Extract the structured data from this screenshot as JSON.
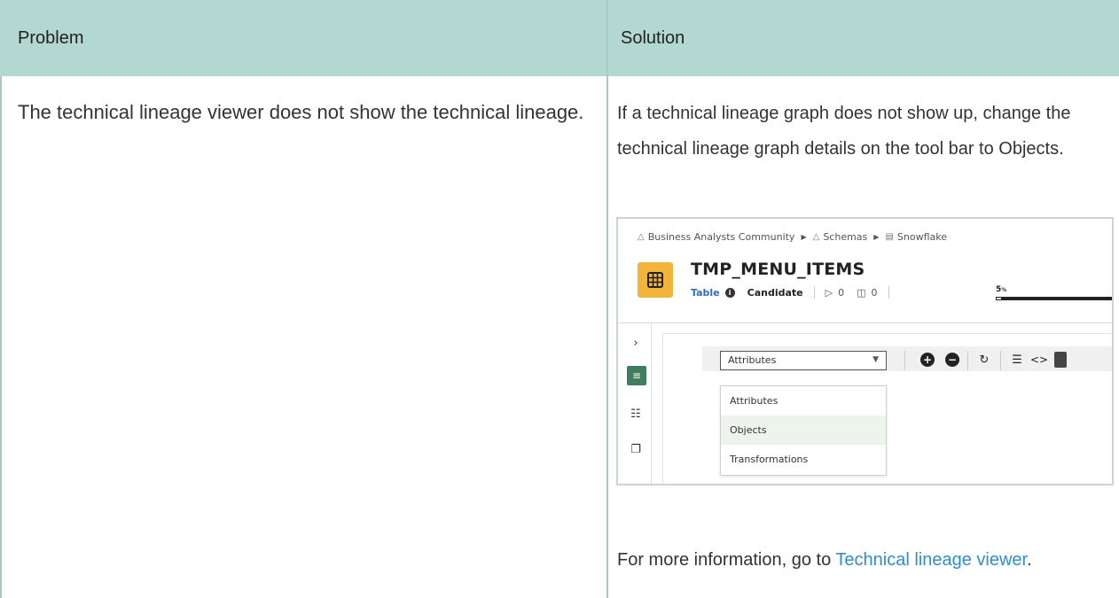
{
  "header": {
    "problem_label": "Problem",
    "solution_label": "Solution"
  },
  "row": {
    "problem_text": "The technical lineage viewer does not show the technical lineage.",
    "solution_text": "If a technical lineage graph does not show up, change the technical lineage graph details on the tool bar to Objects.",
    "more_info_prefix": "For more information, go to ",
    "more_info_link": "Technical lineage viewer",
    "more_info_suffix": "."
  },
  "screenshot": {
    "breadcrumb": [
      "Business Analysts Community",
      "Schemas",
      "Snowflake"
    ],
    "asset_title": "TMP_MENU_ITEMS",
    "asset_type": "Table",
    "asset_status": "Candidate",
    "tag_count": "0",
    "comment_count": "0",
    "completeness_label": "5",
    "completeness_unit": "%",
    "completeness_fraction": 0.05,
    "selected_option": "Attributes",
    "options": [
      "Attributes",
      "Objects",
      "Transformations"
    ],
    "highlighted_option": "Objects"
  },
  "colors": {
    "header_bg": "#b3d8d1",
    "divider": "#a7cac4",
    "link": "#2f8ec9",
    "asset_tile": "#f2b53a",
    "active_side_icon": "#3e7d5f",
    "option_hover": "#edf4eb"
  },
  "icons": {
    "community": "community-icon",
    "schema": "schema-icon",
    "database": "database-icon",
    "table_asset": "table-grid-icon",
    "info": "info-icon",
    "tag": "tag-icon",
    "comment": "comment-icon"
  }
}
